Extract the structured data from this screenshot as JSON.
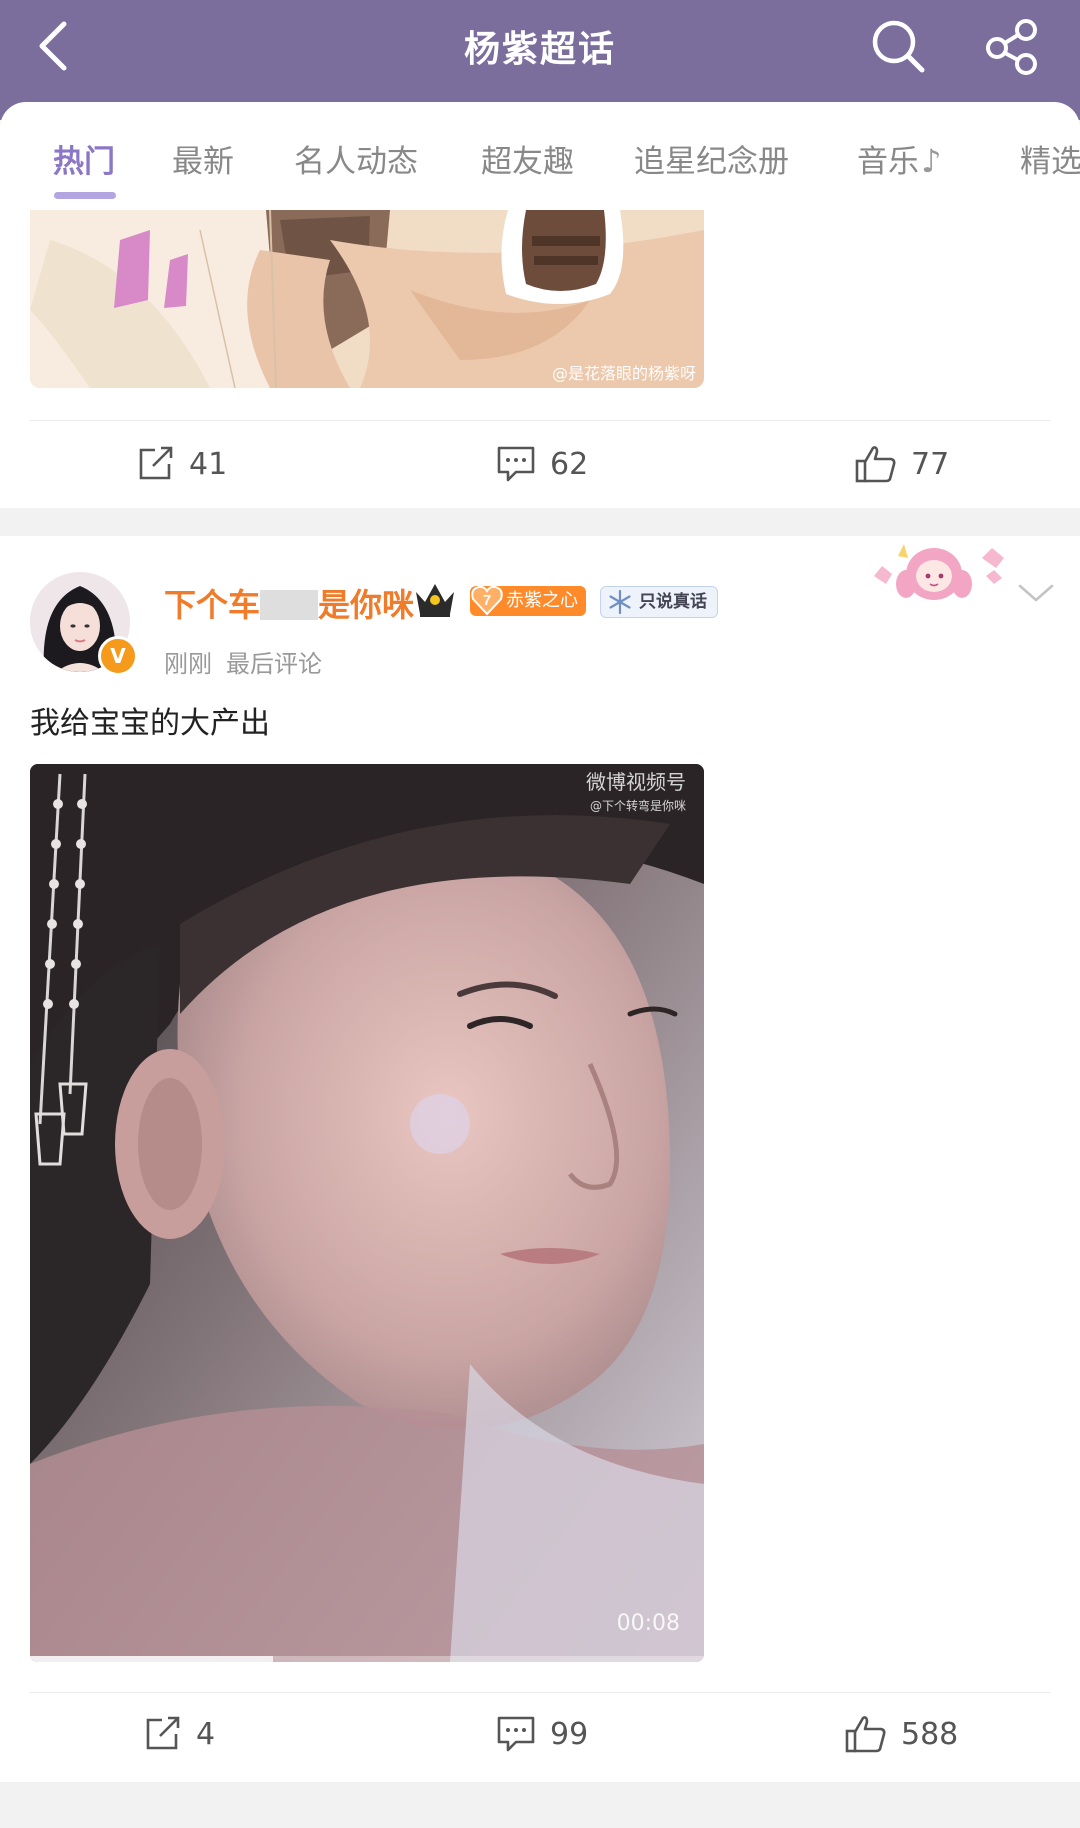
{
  "header": {
    "title": "杨紫超话",
    "back_icon": "back-chevron-icon",
    "search_icon": "search-icon",
    "share_icon": "share-icon",
    "background": "#7b6e9d"
  },
  "tabs": [
    {
      "label": "热门",
      "active": true
    },
    {
      "label": "最新",
      "active": false
    },
    {
      "label": "名人动态",
      "active": false
    },
    {
      "label": "超友趣",
      "active": false
    },
    {
      "label": "追星纪念册",
      "active": false
    },
    {
      "label": "音乐",
      "active": false
    },
    {
      "label": "精选",
      "active": false
    }
  ],
  "accent": "#8c77c7",
  "previous_post": {
    "image_watermark": "@是花落眼的杨紫呀",
    "actions": {
      "repost": "41",
      "comment": "62",
      "like": "77"
    }
  },
  "post": {
    "username_prefix": "下个车",
    "username_suffix": "是你咪",
    "fan_badge_level": "7",
    "fan_badge_label": "赤紫之心",
    "title_badge_label": "只说真话",
    "verified_mark": "V",
    "time": "刚刚",
    "time_note": "最后评论",
    "text": "我给宝宝的大产出",
    "video": {
      "watermark": "微博视频号",
      "watermark_sub": "@下个转弯是你咪",
      "duration": "00:08",
      "progress": 0.36
    },
    "actions": {
      "repost": "4",
      "comment": "99",
      "like": "588"
    }
  }
}
